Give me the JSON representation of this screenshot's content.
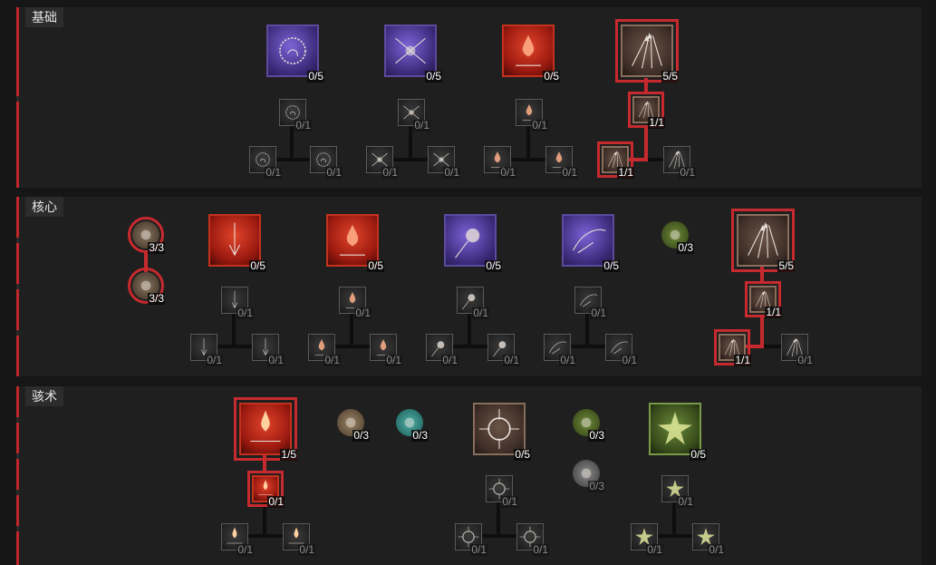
{
  "sections": [
    {
      "label": "基础"
    },
    {
      "label": "核心"
    },
    {
      "label": "骇术"
    }
  ],
  "nodes": {
    "s1_bone_spirit": {
      "icon": "bone-prison-icon",
      "count": "0/5"
    },
    "s1_bone_spirit_u": {
      "icon": "bone-prison-upgrade-icon",
      "count": "0/1"
    },
    "s1_bone_spirit_a": {
      "icon": "bone-prison-variant-a-icon",
      "count": "0/1"
    },
    "s1_bone_spirit_b": {
      "icon": "bone-prison-variant-b-icon",
      "count": "0/1"
    },
    "s1_skull": {
      "icon": "crossed-bones-icon",
      "count": "0/5"
    },
    "s1_skull_u": {
      "icon": "crossed-bones-upgrade-icon",
      "count": "0/1"
    },
    "s1_skull_a": {
      "icon": "crossed-bones-variant-a-icon",
      "count": "0/1"
    },
    "s1_skull_b": {
      "icon": "crossed-bones-variant-b-icon",
      "count": "0/1"
    },
    "s1_blood": {
      "icon": "blood-hand-icon",
      "count": "0/5"
    },
    "s1_blood_u": {
      "icon": "blood-hand-upgrade-icon",
      "count": "0/1"
    },
    "s1_blood_a": {
      "icon": "blood-hand-variant-a-icon",
      "count": "0/1"
    },
    "s1_blood_b": {
      "icon": "blood-hand-variant-b-icon",
      "count": "0/1"
    },
    "s1_bone_splinters": {
      "icon": "bone-splinters-icon",
      "count": "5/5"
    },
    "s1_bone_splinters_u": {
      "icon": "bone-splinters-upgrade-icon",
      "count": "1/1"
    },
    "s1_bone_splinters_a": {
      "icon": "bone-splinters-variant-a-icon",
      "count": "1/1"
    },
    "s1_bone_splinters_b": {
      "icon": "bone-splinters-variant-b-icon",
      "count": "0/1"
    },
    "s2_passive_a": {
      "icon": "bone-shield-passive-icon",
      "count": "3/3"
    },
    "s2_passive_b": {
      "icon": "bone-shield-passive-b-icon",
      "count": "3/3"
    },
    "s2_blood_lance": {
      "icon": "blood-lance-icon",
      "count": "0/5"
    },
    "s2_blood_lance_u": {
      "icon": "blood-lance-upgrade-icon",
      "count": "0/1"
    },
    "s2_blood_lance_a": {
      "icon": "blood-lance-variant-a-icon",
      "count": "0/1"
    },
    "s2_blood_lance_b": {
      "icon": "blood-lance-variant-b-icon",
      "count": "0/1"
    },
    "s2_blood_surge": {
      "icon": "blood-surge-icon",
      "count": "0/5"
    },
    "s2_blood_surge_u": {
      "icon": "blood-surge-upgrade-icon",
      "count": "0/1"
    },
    "s2_blood_surge_a": {
      "icon": "blood-surge-variant-a-icon",
      "count": "0/1"
    },
    "s2_blood_surge_b": {
      "icon": "blood-surge-variant-b-icon",
      "count": "0/1"
    },
    "s2_blight": {
      "icon": "blight-orb-icon",
      "count": "0/5"
    },
    "s2_blight_u": {
      "icon": "blight-orb-upgrade-icon",
      "count": "0/1"
    },
    "s2_blight_a": {
      "icon": "blight-orb-variant-a-icon",
      "count": "0/1"
    },
    "s2_blight_b": {
      "icon": "blight-orb-variant-b-icon",
      "count": "0/1"
    },
    "s2_sever": {
      "icon": "scythe-sever-icon",
      "count": "0/5"
    },
    "s2_sever_u": {
      "icon": "scythe-sever-upgrade-icon",
      "count": "0/1"
    },
    "s2_sever_a": {
      "icon": "scythe-sever-variant-a-icon",
      "count": "0/1"
    },
    "s2_sever_b": {
      "icon": "scythe-sever-variant-b-icon",
      "count": "0/1"
    },
    "s2_green_passive": {
      "icon": "green-passive-icon",
      "count": "0/3"
    },
    "s2_bone_spear": {
      "icon": "bone-spear-icon",
      "count": "5/5"
    },
    "s2_bone_spear_u": {
      "icon": "bone-spear-upgrade-icon",
      "count": "1/1"
    },
    "s2_bone_spear_a": {
      "icon": "bone-spear-variant-a-icon",
      "count": "1/1"
    },
    "s2_bone_spear_b": {
      "icon": "bone-spear-variant-b-icon",
      "count": "0/1"
    },
    "s3_corpse_explosion": {
      "icon": "corpse-explosion-icon",
      "count": "1/5"
    },
    "s3_corpse_explosion_u": {
      "icon": "corpse-explosion-upgrade-icon",
      "count": "0/1"
    },
    "s3_corpse_explosion_a": {
      "icon": "corpse-explosion-variant-a-icon",
      "count": "0/1"
    },
    "s3_corpse_explosion_b": {
      "icon": "corpse-explosion-variant-b-icon",
      "count": "0/1"
    },
    "s3_passive_tan": {
      "icon": "hand-passive-icon",
      "count": "0/3"
    },
    "s3_passive_teal": {
      "icon": "skull-teal-passive-icon",
      "count": "0/3"
    },
    "s3_corpse_tendrils": {
      "icon": "corpse-tendrils-icon",
      "count": "0/5"
    },
    "s3_corpse_tendrils_u": {
      "icon": "corpse-tendrils-upgrade-icon",
      "count": "0/1"
    },
    "s3_corpse_tendrils_a": {
      "icon": "corpse-tendrils-variant-a-icon",
      "count": "0/1"
    },
    "s3_corpse_tendrils_b": {
      "icon": "corpse-tendrils-variant-b-icon",
      "count": "0/1"
    },
    "s3_passive_green": {
      "icon": "green-skull-passive-icon",
      "count": "0/3"
    },
    "s3_passive_grey": {
      "icon": "grey-burst-passive-icon",
      "count": "0/3"
    },
    "s3_blight_burst": {
      "icon": "blight-burst-icon",
      "count": "0/5"
    },
    "s3_blight_burst_u": {
      "icon": "blight-burst-upgrade-icon",
      "count": "0/1"
    },
    "s3_blight_burst_a": {
      "icon": "blight-burst-variant-a-icon",
      "count": "0/1"
    },
    "s3_blight_burst_b": {
      "icon": "blight-burst-variant-b-icon",
      "count": "0/1"
    }
  },
  "colors": {
    "selected": "#c62a2e",
    "connector": "#101010",
    "panel": "#1f1f1f"
  }
}
